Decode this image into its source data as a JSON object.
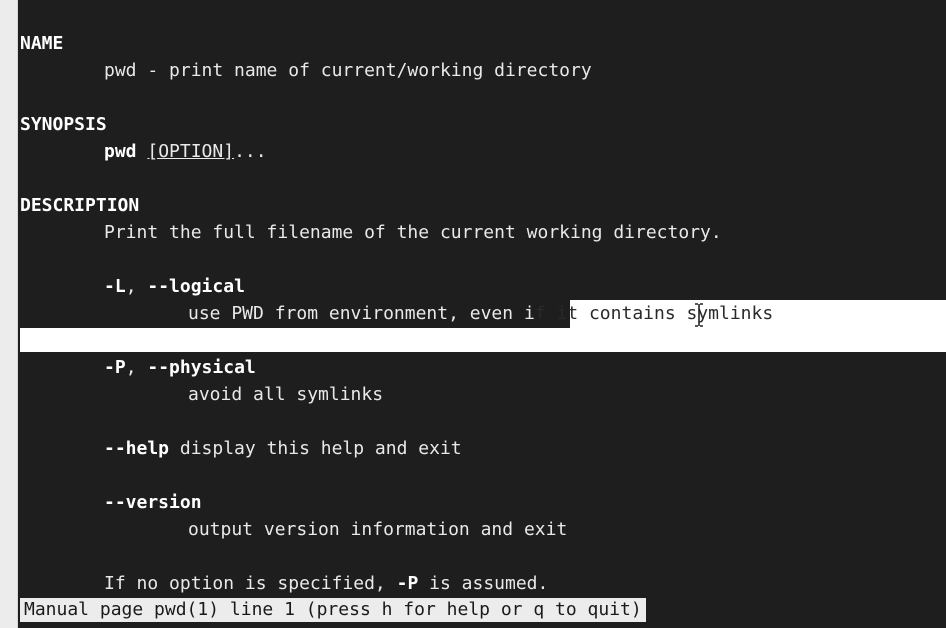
{
  "man": {
    "name_heading": "NAME",
    "name_line": "pwd - print name of current/working directory",
    "synopsis_heading": "SYNOPSIS",
    "synopsis_cmd": "pwd",
    "synopsis_option": "[OPTION]",
    "synopsis_ellipsis": "...",
    "description_heading": "DESCRIPTION",
    "description_line": "Print the full filename of the current working directory.",
    "opt_L_short": "-L",
    "opt_sep": ", ",
    "opt_L_long": "--logical",
    "opt_L_desc_a": "use PWD from environment, even i",
    "opt_L_desc_b": "f it contains symlinks",
    "opt_P_short": "-P",
    "opt_P_long": "--physical",
    "opt_P_desc": "avoid all symlinks",
    "opt_help": "--help",
    "opt_help_desc": " display this help and exit",
    "opt_version": "--version",
    "opt_version_desc": "output version information and exit",
    "default_a": "If no option is specified, ",
    "default_b": "-P",
    "default_c": " is assumed."
  },
  "status": {
    "text": "Manual page pwd(1) line 1 (press h for help or q to quit)"
  },
  "colors": {
    "background": "#1e1e1e",
    "text": "#e9e9e9",
    "selection": "#ffffff",
    "status_bg": "#ececec"
  },
  "cursor": {
    "type": "ibeam-icon"
  }
}
